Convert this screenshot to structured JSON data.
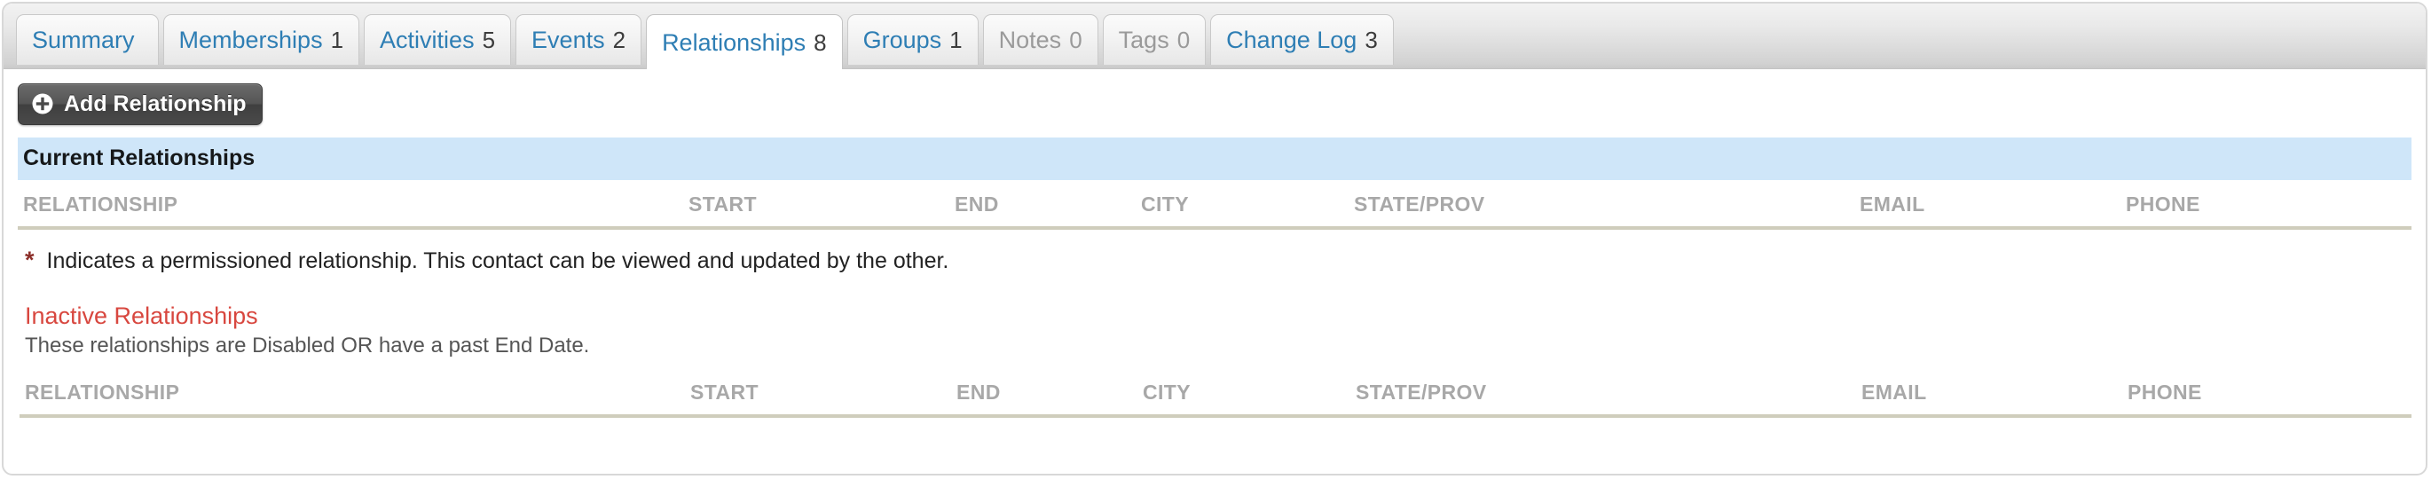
{
  "tabs": [
    {
      "label": "Summary",
      "count": "",
      "state": "normal"
    },
    {
      "label": "Memberships",
      "count": "1",
      "state": "normal"
    },
    {
      "label": "Activities",
      "count": "5",
      "state": "normal"
    },
    {
      "label": "Events",
      "count": "2",
      "state": "normal"
    },
    {
      "label": "Relationships",
      "count": "8",
      "state": "active"
    },
    {
      "label": "Groups",
      "count": "1",
      "state": "normal"
    },
    {
      "label": "Notes",
      "count": "0",
      "state": "muted"
    },
    {
      "label": "Tags",
      "count": "0",
      "state": "muted"
    },
    {
      "label": "Change Log",
      "count": "3",
      "state": "normal"
    }
  ],
  "toolbar": {
    "add_relationship_label": "Add Relationship",
    "add_icon": "plus-circle-icon"
  },
  "current_section": {
    "heading": "Current Relationships",
    "heading_bg": "#cfe6f9"
  },
  "columns": [
    "RELATIONSHIP",
    "START",
    "END",
    "CITY",
    "STATE/PROV",
    "EMAIL",
    "PHONE"
  ],
  "footnote": {
    "marker": "*",
    "marker_color": "#8c2f2a",
    "text": "Indicates a permissioned relationship. This contact can be viewed and updated by the other."
  },
  "inactive_section": {
    "heading": "Inactive Relationships",
    "heading_color": "#d8473f",
    "description": "These relationships are Disabled OR have a past End Date."
  },
  "rows": {
    "current": [],
    "inactive": []
  }
}
